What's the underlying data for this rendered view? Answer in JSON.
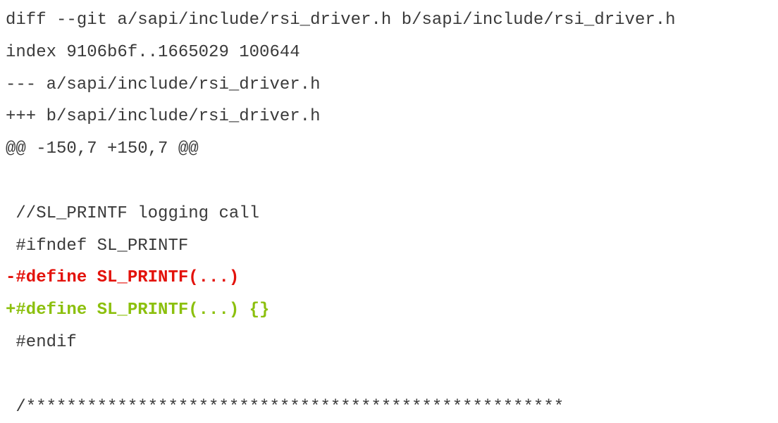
{
  "colors": {
    "text": "#3a3a3a",
    "removed": "#e3120b",
    "added": "#8cc00e",
    "background": "#ffffff"
  },
  "diff": {
    "header_git": "diff --git a/sapi/include/rsi_driver.h b/sapi/include/rsi_driver.h",
    "header_index": "index 9106b6f..1665029 100644",
    "header_old_file": "--- a/sapi/include/rsi_driver.h",
    "header_new_file": "+++ b/sapi/include/rsi_driver.h",
    "hunk_header": "@@ -150,7 +150,7 @@",
    "lines": [
      "",
      " //SL_PRINTF logging call",
      " #ifndef SL_PRINTF",
      "-#define SL_PRINTF(...)",
      "+#define SL_PRINTF(...) {}",
      " #endif",
      "",
      " /*****************************************************"
    ]
  }
}
